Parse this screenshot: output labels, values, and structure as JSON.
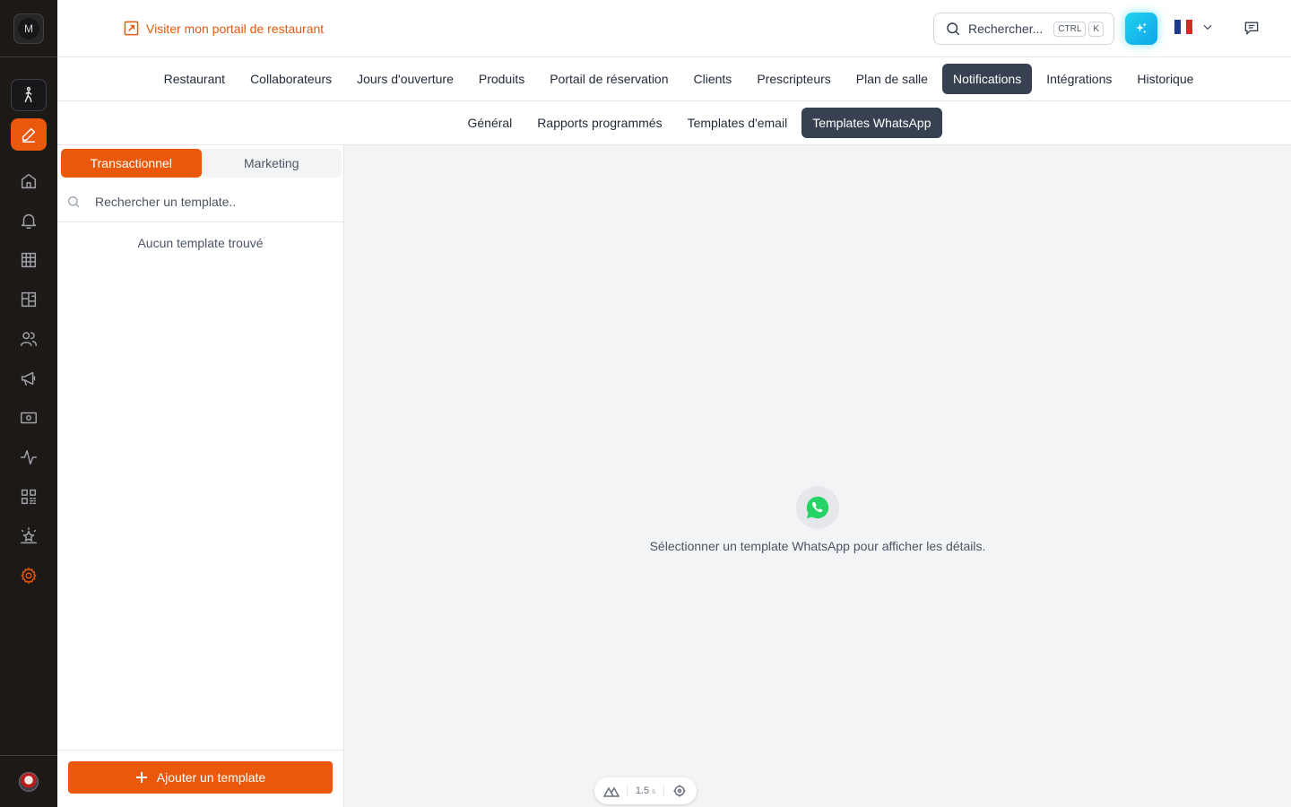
{
  "app": {
    "workspace_initial": "M",
    "accent_color": "#ea580c",
    "rail_color": "#1c1917"
  },
  "rail": {
    "items": [
      {
        "icon": "walking-person-icon"
      },
      {
        "icon": "pen-edit-icon",
        "state": "active"
      },
      {
        "icon": "home-icon"
      },
      {
        "icon": "bell-icon"
      },
      {
        "icon": "grid-table-icon"
      },
      {
        "icon": "floor-plan-icon"
      },
      {
        "icon": "users-icon"
      },
      {
        "icon": "megaphone-icon"
      },
      {
        "icon": "cash-icon"
      },
      {
        "icon": "activity-pulse-icon"
      },
      {
        "icon": "qr-code-icon"
      },
      {
        "icon": "sparkle-star-icon"
      },
      {
        "icon": "gear-icon",
        "state": "selected"
      }
    ]
  },
  "header": {
    "portal_link": "Visiter mon portail de restaurant",
    "search": {
      "label": "Rechercher...",
      "kbd1": "CTRL",
      "kbd2": "K"
    },
    "ai_icon": "sparkles-icon",
    "language": "fr",
    "chat_icon": "message-icon"
  },
  "tabs_primary": {
    "items": [
      "Restaurant",
      "Collaborateurs",
      "Jours d'ouverture",
      "Produits",
      "Portail de réservation",
      "Clients",
      "Prescripteurs",
      "Plan de salle",
      "Notifications",
      "Intégrations",
      "Historique"
    ],
    "active": "Notifications"
  },
  "tabs_secondary": {
    "items": [
      "Général",
      "Rapports programmés",
      "Templates d'email",
      "Templates WhatsApp"
    ],
    "active": "Templates WhatsApp"
  },
  "panel": {
    "segments": [
      "Transactionnel",
      "Marketing"
    ],
    "active_segment": "Transactionnel",
    "search_placeholder": "Rechercher un template..",
    "search_value": "",
    "empty_text": "Aucun template trouvé",
    "add_button": "Ajouter un template"
  },
  "main": {
    "empty_icon": "whatsapp-icon",
    "message": "Sélectionner un template WhatsApp pour afficher les détails."
  },
  "devtools": {
    "time_value": "1.5",
    "time_unit": "s"
  }
}
